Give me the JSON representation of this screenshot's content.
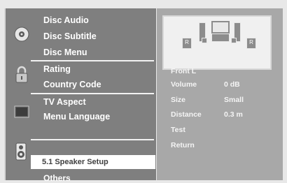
{
  "menu": {
    "disc_audio": "Disc Audio",
    "disc_subtitle": "Disc Subtitle",
    "disc_menu": "Disc Menu",
    "rating": "Rating",
    "country_code": "Country Code",
    "tv_aspect": "TV Aspect",
    "menu_language": "Menu Language",
    "speaker_setup": "5.1 Speaker Setup",
    "others": "Others"
  },
  "speaker_diagram": {
    "left_label": "R",
    "right_label": "R"
  },
  "speaker_settings": {
    "channel": "Front L",
    "volume_label": "Volume",
    "volume_value": "0 dB",
    "size_label": "Size",
    "size_value": "Small",
    "distance_label": "Distance",
    "distance_value": "0.3 m",
    "test_label": "Test",
    "return_label": "Return"
  },
  "colors": {
    "menu_bg": "#7f7f7f",
    "submenu_bg": "#a8a8a8",
    "highlight": "#ffffff",
    "text": "#ffffff"
  }
}
